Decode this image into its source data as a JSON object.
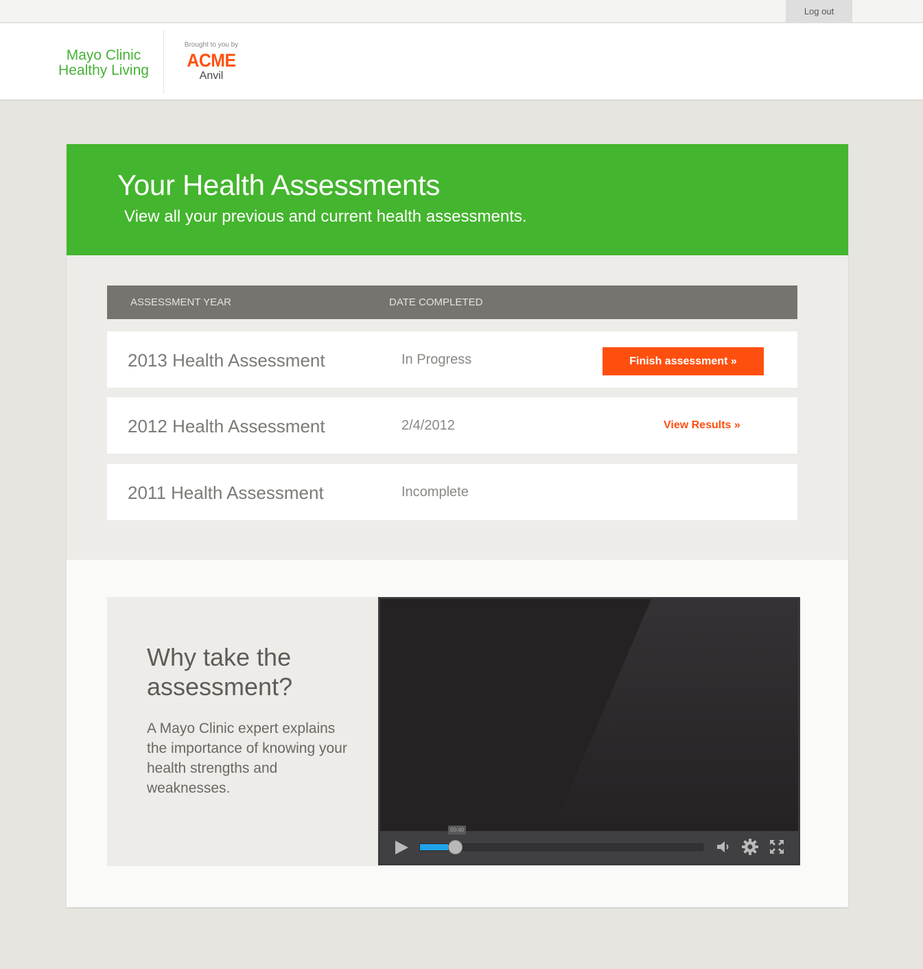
{
  "topbar": {
    "logout_label": "Log out"
  },
  "header": {
    "brand_line1": "Mayo Clinic",
    "brand_line2": "Healthy Living",
    "sponsor_tagline": "Brought to you by",
    "sponsor_name": "ACME",
    "sponsor_sub": "Anvil"
  },
  "hero": {
    "title": "Your Health Assessments",
    "subtitle": "View all your previous and current health assessments."
  },
  "table": {
    "headers": [
      "ASSESSMENT YEAR",
      "DATE COMPLETED"
    ],
    "rows": [
      {
        "name": "2013 Health Assessment",
        "status": "In Progress",
        "action": "Finish assessment »"
      },
      {
        "name": "2012 Health Assessment",
        "status": "2/4/2012",
        "action": "View Results »"
      },
      {
        "name": "2011 Health Assessment",
        "status": "Incomplete",
        "action": ""
      }
    ]
  },
  "why": {
    "title": "Why take the assessment?",
    "text": "A Mayo Clinic expert explains the importance of knowing your health strengths and weaknesses."
  },
  "video": {
    "current_time": "00:40",
    "progress": 0.075,
    "colors": {
      "progress": "#1fa3ea",
      "screen": "#252224"
    }
  },
  "colors": {
    "brand_green": "#44b52e",
    "accent_orange": "#ff4f0f",
    "table_header": "#76746f"
  }
}
